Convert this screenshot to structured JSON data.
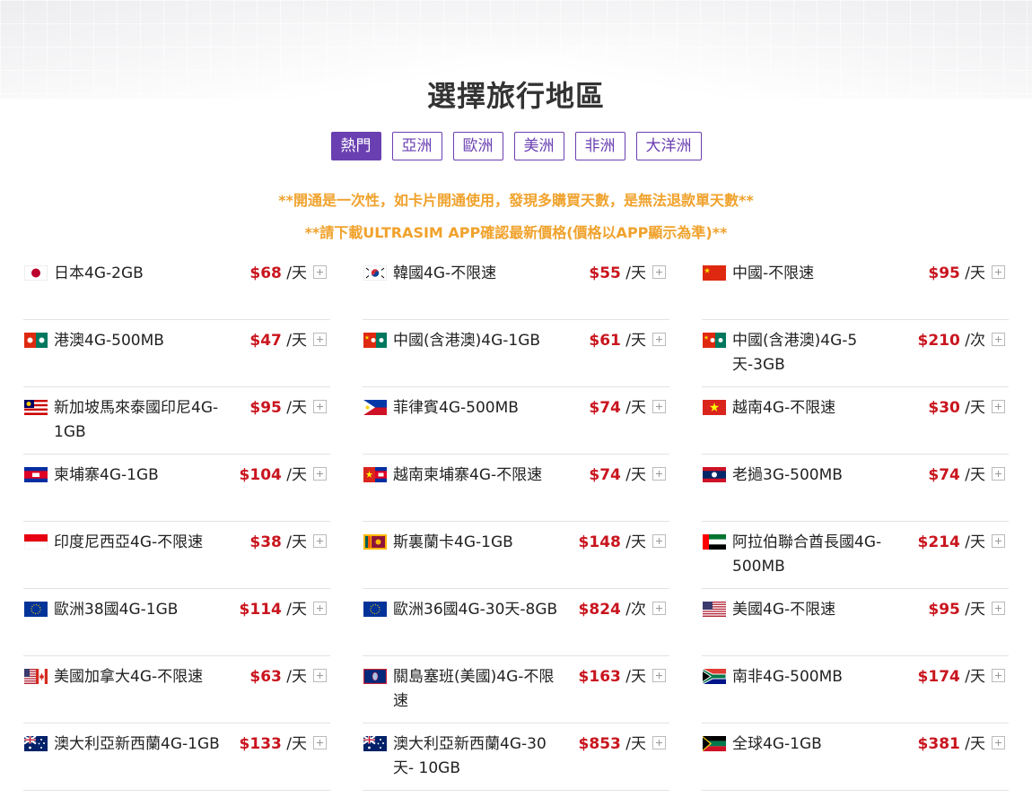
{
  "title": "選擇旅行地區",
  "tabs": [
    {
      "label": "熱門",
      "active": true
    },
    {
      "label": "亞洲",
      "active": false
    },
    {
      "label": "歐洲",
      "active": false
    },
    {
      "label": "美洲",
      "active": false
    },
    {
      "label": "非洲",
      "active": false
    },
    {
      "label": "大洋洲",
      "active": false
    }
  ],
  "notices": [
    "**開通是一次性，如卡片開通使用，發現多購買天數，是無法退款單天數**",
    "**請下載ULTRASIM APP確認最新價格(價格以APP顯示為準)**"
  ],
  "colors": {
    "accent": "#6a3fb1",
    "notice": "#f0a22c",
    "price": "#c9151e"
  },
  "products": [
    {
      "flag": "japan-flag",
      "name": "日本4G-2GB",
      "price": "$68",
      "unit": "/天"
    },
    {
      "flag": "korea-flag",
      "name": "韓國4G-不限速",
      "price": "$55",
      "unit": "/天"
    },
    {
      "flag": "china-flag",
      "name": "中國-不限速",
      "price": "$95",
      "unit": "/天"
    },
    {
      "flag": "hongkong-macau-flag",
      "name": "港澳4G-500MB",
      "price": "$47",
      "unit": "/天"
    },
    {
      "flag": "china-hk-macau-flag",
      "name": "中國(含港澳)4G-1GB",
      "price": "$61",
      "unit": "/天"
    },
    {
      "flag": "china-hk-macau-flag",
      "name": "中國(含港澳)4G-5天-3GB",
      "price": "$210",
      "unit": "/次"
    },
    {
      "flag": "sea-flag",
      "name": "新加坡馬來泰國印尼4G-1GB",
      "price": "$95",
      "unit": "/天"
    },
    {
      "flag": "philippines-flag",
      "name": "菲律賓4G-500MB",
      "price": "$74",
      "unit": "/天"
    },
    {
      "flag": "vietnam-flag",
      "name": "越南4G-不限速",
      "price": "$30",
      "unit": "/天"
    },
    {
      "flag": "cambodia-flag",
      "name": "柬埔寨4G-1GB",
      "price": "$104",
      "unit": "/天"
    },
    {
      "flag": "vietnam-cambodia-flag",
      "name": "越南柬埔寨4G-不限速",
      "price": "$74",
      "unit": "/天"
    },
    {
      "flag": "laos-flag",
      "name": "老撾3G-500MB",
      "price": "$74",
      "unit": "/天"
    },
    {
      "flag": "indonesia-flag",
      "name": "印度尼西亞4G-不限速",
      "price": "$38",
      "unit": "/天"
    },
    {
      "flag": "srilanka-flag",
      "name": "斯裏蘭卡4G-1GB",
      "price": "$148",
      "unit": "/天"
    },
    {
      "flag": "uae-flag",
      "name": "阿拉伯聯合酋長國4G-500MB",
      "price": "$214",
      "unit": "/天"
    },
    {
      "flag": "eu-flag",
      "name": "歐洲38國4G-1GB",
      "price": "$114",
      "unit": "/天"
    },
    {
      "flag": "eu-flag",
      "name": "歐洲36國4G-30天-8GB",
      "price": "$824",
      "unit": "/次"
    },
    {
      "flag": "usa-flag",
      "name": "美國4G-不限速",
      "price": "$95",
      "unit": "/天"
    },
    {
      "flag": "usa-canada-flag",
      "name": "美國加拿大4G-不限速",
      "price": "$63",
      "unit": "/天"
    },
    {
      "flag": "guam-flag",
      "name": "關島塞班(美國)4G-不限速",
      "price": "$163",
      "unit": "/天"
    },
    {
      "flag": "south-africa-flag",
      "name": "南非4G-500MB",
      "price": "$174",
      "unit": "/天"
    },
    {
      "flag": "australia-flag",
      "name": "澳大利亞新西蘭4G-1GB",
      "price": "$133",
      "unit": "/天"
    },
    {
      "flag": "australia-flag",
      "name": "澳大利亞新西蘭4G-30天- 10GB",
      "price": "$853",
      "unit": "/天"
    },
    {
      "flag": "global-flag",
      "name": "全球4G-1GB",
      "price": "$381",
      "unit": "/天"
    }
  ]
}
